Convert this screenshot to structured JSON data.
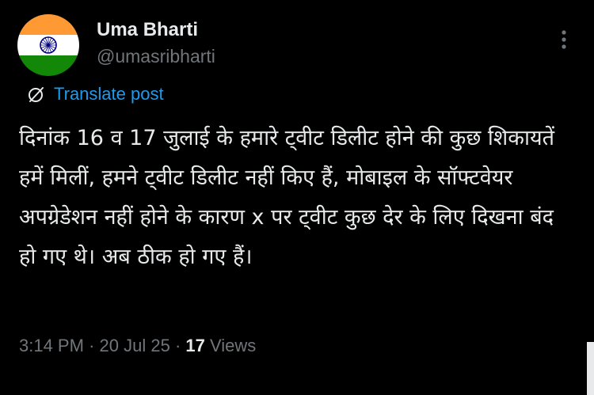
{
  "post": {
    "author": {
      "display_name": "Uma Bharti",
      "handle": "@umasribharti",
      "avatar_icon": "india-flag-icon"
    },
    "translate_label": "Translate post",
    "text": "दिनांक 16 व 17 जुलाई के हमारे ट्वीट डिलीट होने की कुछ शिकायतें हमें मिलीं, हमने ट्वीट डिलीट नहीं किए हैं, मोबाइल के सॉफ्टवेयर अपग्रेडेशन नहीं होने के कारण x पर ट्वीट कुछ देर के लिए दिखना बंद हो गए थे। अब ठीक हो गए हैं।",
    "time": "3:14 PM",
    "separator": "·",
    "date": "20 Jul 25",
    "views_count": "17",
    "views_label": "Views"
  },
  "colors": {
    "background": "#000000",
    "text_primary": "#e7e9ea",
    "text_secondary": "#71767b",
    "link": "#1d9bf0",
    "saffron": "#ff9933",
    "green": "#138808",
    "chakra": "#000080"
  }
}
